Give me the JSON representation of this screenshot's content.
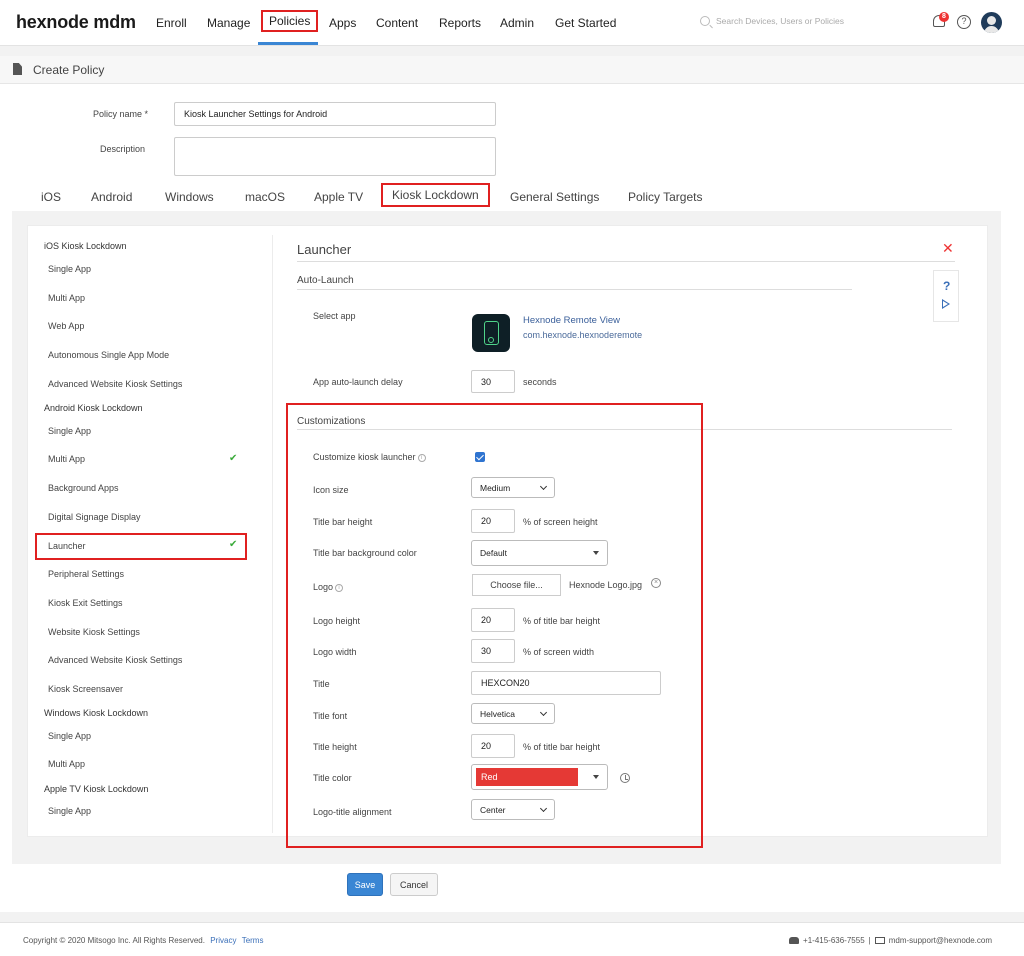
{
  "header": {
    "logo": "hexnode mdm",
    "nav": [
      "Enroll",
      "Manage",
      "Policies",
      "Apps",
      "Content",
      "Reports",
      "Admin",
      "Get Started"
    ],
    "active_nav": "Policies",
    "search_placeholder": "Search Devices, Users or Policies",
    "notification_count": "8",
    "help_symbol": "?"
  },
  "page": {
    "title": "Create Policy"
  },
  "form": {
    "policy_name_label": "Policy name *",
    "policy_name_value": "Kiosk Launcher Settings for Android",
    "description_label": "Description",
    "description_value": ""
  },
  "tabs": [
    "iOS",
    "Android",
    "Windows",
    "macOS",
    "Apple TV",
    "Kiosk Lockdown",
    "General Settings",
    "Policy Targets"
  ],
  "active_tab": "Kiosk Lockdown",
  "sidebar": {
    "groups": [
      {
        "title": "iOS Kiosk Lockdown",
        "items": [
          "Single App",
          "Multi App",
          "Web App",
          "Autonomous Single App Mode",
          "Advanced Website Kiosk Settings"
        ]
      },
      {
        "title": "Android Kiosk Lockdown",
        "items": [
          "Single App",
          "Multi App",
          "Background Apps",
          "Digital Signage Display",
          "Launcher",
          "Peripheral Settings",
          "Kiosk Exit Settings",
          "Website Kiosk Settings",
          "Advanced Website Kiosk Settings",
          "Kiosk Screensaver"
        ]
      },
      {
        "title": "Windows Kiosk Lockdown",
        "items": [
          "Single App",
          "Multi App"
        ]
      },
      {
        "title": "Apple TV Kiosk Lockdown",
        "items": [
          "Single App"
        ]
      }
    ],
    "active_item": "Launcher",
    "checkmark": "✔"
  },
  "main": {
    "section_title": "Launcher",
    "close_symbol": "✕",
    "auto_launch": {
      "title": "Auto-Launch",
      "select_app_label": "Select app",
      "app_name": "Hexnode Remote View",
      "app_package": "com.hexnode.hexnoderemote",
      "delay_label": "App auto-launch delay",
      "delay_value": "30",
      "delay_unit": "seconds"
    },
    "customizations": {
      "title": "Customizations",
      "customize_label": "Customize kiosk launcher",
      "customize_checked": true,
      "icon_size_label": "Icon size",
      "icon_size_value": "Medium",
      "title_bar_height_label": "Title bar height",
      "title_bar_height_value": "20",
      "title_bar_height_unit": "% of screen height",
      "title_bar_bg_label": "Title bar background color",
      "title_bar_bg_value": "Default",
      "logo_label": "Logo",
      "choose_file_label": "Choose file...",
      "logo_file": "Hexnode Logo.jpg",
      "logo_height_label": "Logo height",
      "logo_height_value": "20",
      "logo_height_unit": "% of title bar height",
      "logo_width_label": "Logo width",
      "logo_width_value": "30",
      "logo_width_unit": "% of screen width",
      "title_label": "Title",
      "title_value": "HEXCON20",
      "title_font_label": "Title font",
      "title_font_value": "Helvetica",
      "title_height_label": "Title height",
      "title_height_value": "20",
      "title_height_unit": "% of title bar height",
      "title_color_label": "Title color",
      "title_color_value": "Red",
      "title_color_hex": "#e53935",
      "alignment_label": "Logo-title alignment",
      "alignment_value": "Center"
    }
  },
  "actions": {
    "save": "Save",
    "cancel": "Cancel"
  },
  "footer": {
    "copyright": "Copyright © 2020 Mitsogo Inc. All Rights Reserved.",
    "privacy": "Privacy",
    "terms": "Terms",
    "phone": "+1-415-636-7555",
    "separator": "|",
    "email": "mdm-support@hexnode.com"
  },
  "colors": {
    "accent": "#3a86d4",
    "highlight": "#e02020",
    "check": "#3bab3b"
  }
}
